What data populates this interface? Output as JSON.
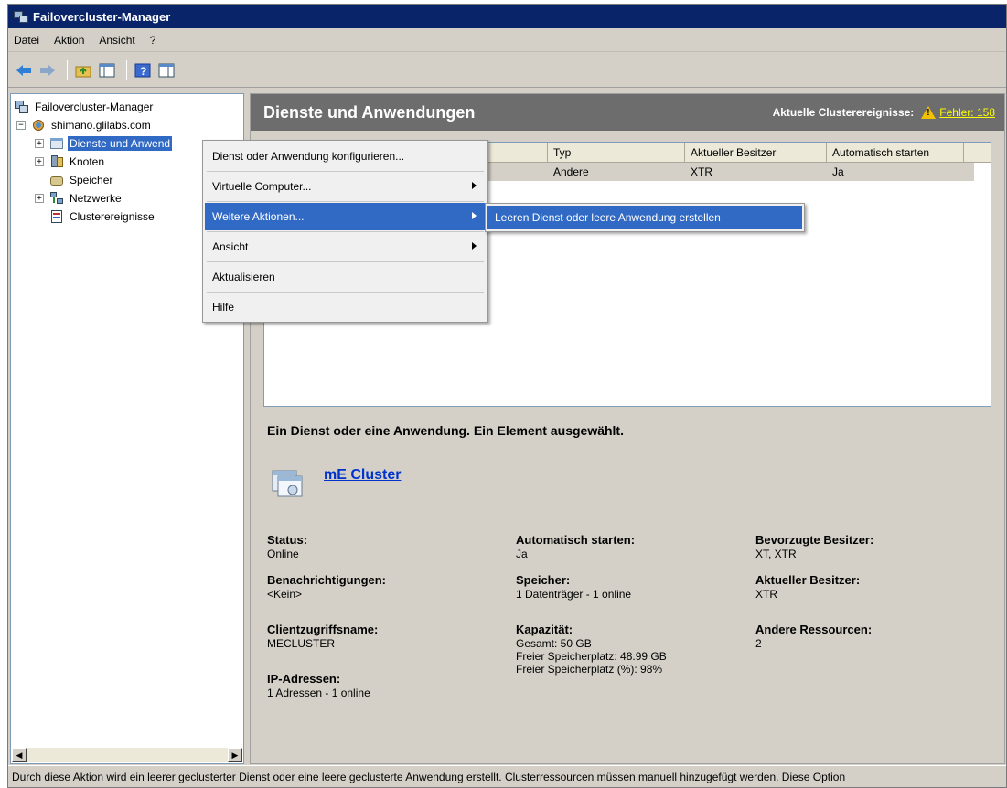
{
  "window": {
    "title": "Failovercluster-Manager"
  },
  "menu": [
    "Datei",
    "Aktion",
    "Ansicht",
    "?"
  ],
  "tree": {
    "root": "Failovercluster-Manager",
    "cluster": "shimano.glilabs.com",
    "items": [
      "Dienste und Anwend",
      "Knoten",
      "Speicher",
      "Netzwerke",
      "Clusterereignisse"
    ]
  },
  "header": {
    "title": "Dienste und Anwendungen",
    "events_label": "Aktuelle Clusterereignisse:",
    "events_link": "Fehler: 158"
  },
  "list": {
    "columns": [
      "Typ",
      "Aktueller Besitzer",
      "Automatisch starten"
    ],
    "rows": [
      {
        "type": "Andere",
        "owner": "XTR",
        "autostart": "Ja"
      }
    ]
  },
  "context_menu": {
    "items": [
      "Dienst oder Anwendung konfigurieren...",
      "Virtuelle Computer...",
      "Weitere Aktionen...",
      "Ansicht",
      "Aktualisieren",
      "Hilfe"
    ],
    "submenu_item": "Leeren Dienst oder leere Anwendung erstellen"
  },
  "detail": {
    "summary": "Ein Dienst oder eine Anwendung. Ein Element ausgewählt.",
    "name": "mE Cluster",
    "fields": {
      "status_label": "Status:",
      "status_value": "Online",
      "notify_label": "Benachrichtigungen:",
      "notify_value": "<Kein>",
      "client_label": "Clientzugriffsname:",
      "client_value": "MECLUSTER",
      "ip_label": "IP-Adressen:",
      "ip_value": "1 Adressen - 1 online",
      "autostart_label": "Automatisch starten:",
      "autostart_value": "Ja",
      "storage_label": "Speicher:",
      "storage_value": "1 Datenträger - 1 online",
      "capacity_label": "Kapazität:",
      "capacity_total": "Gesamt: 50 GB",
      "capacity_free": "Freier Speicherplatz: 48.99 GB",
      "capacity_free_pct": "Freier Speicherplatz (%): 98%",
      "preferred_label": "Bevorzugte Besitzer:",
      "preferred_value": "XT, XTR",
      "owner_label": "Aktueller Besitzer:",
      "owner_value": "XTR",
      "other_label": "Andere Ressourcen:",
      "other_value": "2"
    }
  },
  "statusbar": "Durch diese Aktion wird ein leerer geclusterter Dienst oder eine leere geclusterte Anwendung erstellt. Clusterressourcen müssen manuell hinzugefügt werden. Diese Option",
  "colors": {
    "selection": "#316ac5",
    "header": "#6d6d6d",
    "titlebar": "#0a246a"
  }
}
